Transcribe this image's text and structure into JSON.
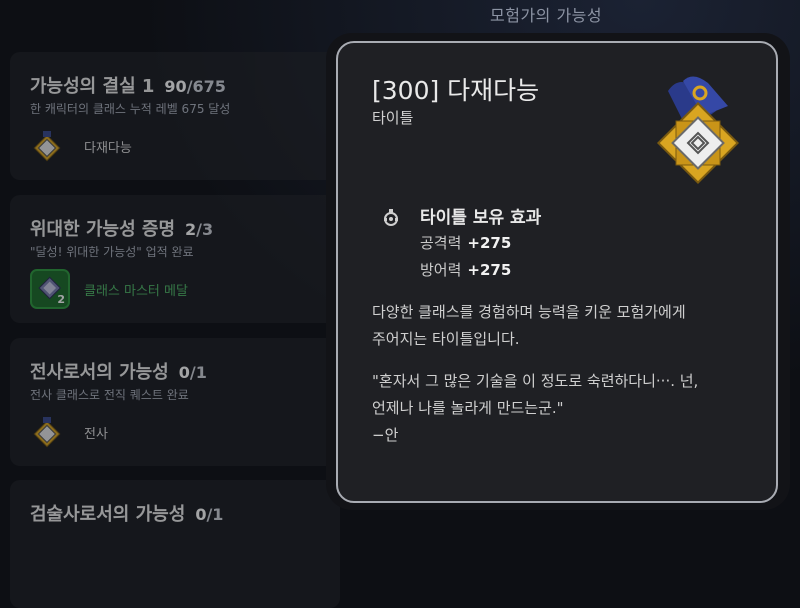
{
  "header": {
    "title": "모험가의 가능성"
  },
  "achievements": [
    {
      "title": "가능성의 결실 1",
      "progress_current": "90",
      "progress_total": "/675",
      "description": "한 캐릭터의 클래스 누적 레벨 675 달성",
      "reward": "다재다능",
      "reward_icon": "medal-icon"
    },
    {
      "title": "위대한 가능성 증명",
      "progress_current": "2",
      "progress_total": "/3",
      "description": "\"달성! 위대한 가능성\" 업적 완료",
      "reward": "클래스 마스터 메달",
      "reward_icon": "class-master-medal-icon",
      "reward_count": "2"
    },
    {
      "title": "전사로서의 가능성",
      "progress_current": "0",
      "progress_total": "/1",
      "description": "전사 클래스로 전직 퀘스트 완료",
      "reward": "전사",
      "reward_icon": "medal-icon"
    },
    {
      "title": "검술사로서의 가능성",
      "progress_current": "0",
      "progress_total": "/1",
      "description": "",
      "reward": "",
      "reward_icon": ""
    }
  ],
  "tooltip": {
    "title": "[300] 다재다능",
    "subtitle": "타이틀",
    "effect_heading": "타이틀 보유 효과",
    "stats": [
      {
        "label": "공격력",
        "value": "+275"
      },
      {
        "label": "방어력",
        "value": "+275"
      }
    ],
    "description_line1": "다양한 클래스를 경험하며 능력을 키운 모험가에게",
    "description_line2": "주어지는 타이틀입니다.",
    "quote_line1": "\"혼자서 그 많은 기술을 이 정도로 숙련하다니···. 넌,",
    "quote_line2": "언제나 나를 놀라게 만드는군.\"",
    "quote_author": "−안"
  },
  "colors": {
    "accent_green": "#4fb766",
    "gold": "#d9a521",
    "background": "#0d0f14"
  }
}
